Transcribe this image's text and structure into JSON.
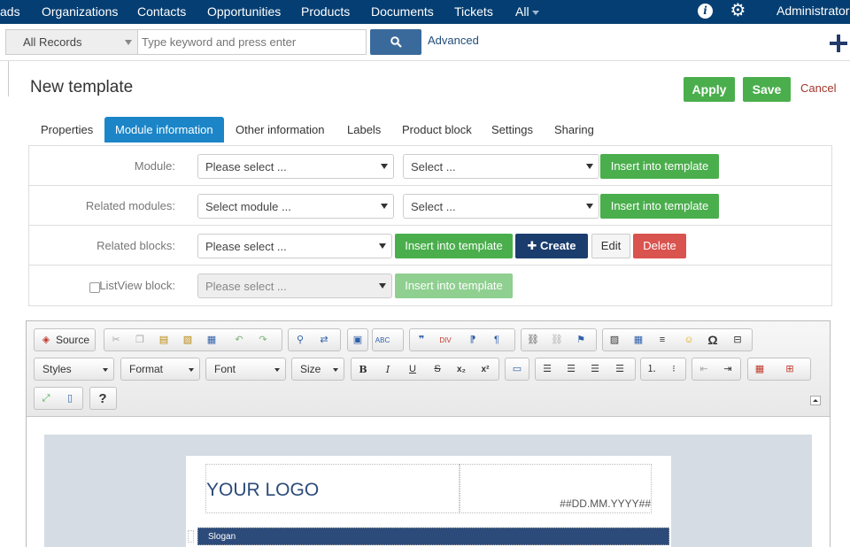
{
  "topnav": {
    "items": [
      "ads",
      "Organizations",
      "Contacts",
      "Opportunities",
      "Products",
      "Documents",
      "Tickets",
      "All"
    ],
    "user": "Administrator",
    "info_icon": "i",
    "gear_icon": "⚙",
    "bg_color": "#053e72"
  },
  "search": {
    "records": "All Records",
    "placeholder": "Type keyword and press enter",
    "advanced": "Advanced"
  },
  "page": {
    "title": "New template",
    "apply": "Apply",
    "save": "Save",
    "cancel": "Cancel"
  },
  "tabs": [
    {
      "label": "Properties",
      "active": false
    },
    {
      "label": "Module information",
      "active": true
    },
    {
      "label": "Other information",
      "active": false
    },
    {
      "label": "Labels",
      "active": false
    },
    {
      "label": "Product block",
      "active": false
    },
    {
      "label": "Settings",
      "active": false
    },
    {
      "label": "Sharing",
      "active": false
    }
  ],
  "form": {
    "module": {
      "label": "Module:",
      "select1": "Please select ...",
      "select2": "Select ...",
      "insert": "Insert into template"
    },
    "related_modules": {
      "label": "Related modules:",
      "select1": "Select module ...",
      "select2": "Select ...",
      "insert": "Insert into template"
    },
    "related_blocks": {
      "label": "Related blocks:",
      "select1": "Please select ...",
      "insert": "Insert into template",
      "create": "Create",
      "edit": "Edit",
      "delete": "Delete"
    },
    "listview": {
      "label": "ListView block:",
      "select1": "Please select ...",
      "insert": "Insert into template"
    }
  },
  "editor": {
    "source": "Source",
    "styles": "Styles",
    "format": "Format",
    "font": "Font",
    "size": "Size",
    "help": "?",
    "bold": "B",
    "italic": "I",
    "underline": "U",
    "strike": "S",
    "subscript": "x₂",
    "superscript": "x²",
    "omega": "Ω"
  },
  "template_content": {
    "logo": "YOUR LOGO",
    "date": "##DD.MM.YYYY##",
    "slogan": "Slogan"
  }
}
